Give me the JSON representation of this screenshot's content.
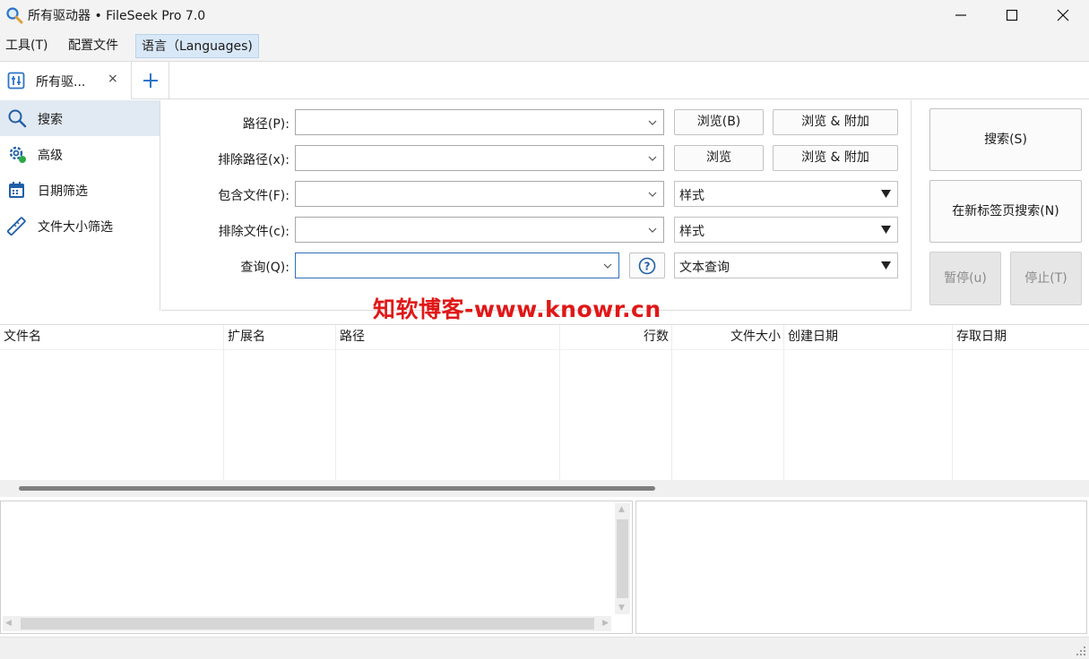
{
  "window": {
    "title": "所有驱动器 • FileSeek Pro 7.0"
  },
  "menu": {
    "tools": "工具(T)",
    "profiles": "配置文件",
    "language": "语言（Languages)"
  },
  "tab": {
    "label": "所有驱...",
    "close": "×"
  },
  "nav": {
    "items": [
      {
        "label": "搜索",
        "icon": "search-icon"
      },
      {
        "label": "高级",
        "icon": "gear-icon"
      },
      {
        "label": "日期筛选",
        "icon": "calendar-icon"
      },
      {
        "label": "文件大小筛选",
        "icon": "ruler-icon"
      }
    ]
  },
  "form": {
    "path_label": "路径(P):",
    "exclude_path_label": "排除路径(x):",
    "include_files_label": "包含文件(F):",
    "exclude_files_label": "排除文件(c):",
    "query_label": "查询(Q):",
    "browse_b": "浏览(B)",
    "browse_append": "浏览 & 附加",
    "browse": "浏览",
    "browse_append2": "浏览 & 附加",
    "pattern1": "样式",
    "pattern2": "样式",
    "text_query": "文本查询",
    "path_value": "",
    "exclude_path_value": "",
    "include_value": "",
    "exclude_value": "",
    "query_value": ""
  },
  "actions": {
    "search": "搜索(S)",
    "search_new_tab": "在新标签页搜索(N)",
    "pause": "暂停(u)",
    "stop": "停止(T)"
  },
  "watermark": "知软博客-www.knowr.cn",
  "results": {
    "columns": [
      "文件名",
      "扩展名",
      "路径",
      "行数",
      "文件大小",
      "创建日期",
      "存取日期"
    ],
    "rows": []
  },
  "colors": {
    "accent": "#2e6fb7",
    "watermark": "#e01818",
    "active_nav": "#e1e9f2"
  }
}
